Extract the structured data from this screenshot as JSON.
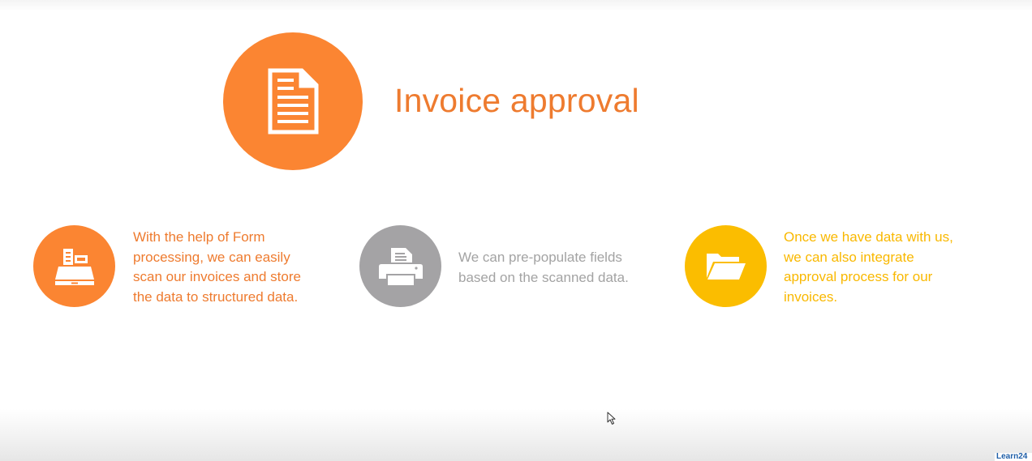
{
  "slide": {
    "title": "Invoice approval",
    "steps": [
      {
        "icon": "cash-register-icon",
        "lines": [
          "With the help of Form",
          "processing, we can easily",
          "scan our invoices and store",
          "the data to structured data."
        ]
      },
      {
        "icon": "printer-icon",
        "lines": [
          "We can pre-populate fields",
          "based on the scanned data."
        ]
      },
      {
        "icon": "folder-open-icon",
        "lines": [
          "Once we have data with us,",
          "we can also integrate",
          "approval process for our",
          "invoices."
        ]
      }
    ]
  },
  "icons": {
    "hero": "document-icon",
    "cursor": "mouse-pointer-icon"
  },
  "watermark": "Learn24",
  "colors": {
    "orange": "#fb8532",
    "orange_text": "#ee7b2f",
    "gray": "#a4a3a5",
    "gray_text": "#a3a3a3",
    "yellow": "#fbbd00",
    "yellow_text": "#f9b800",
    "white": "#ffffff"
  }
}
